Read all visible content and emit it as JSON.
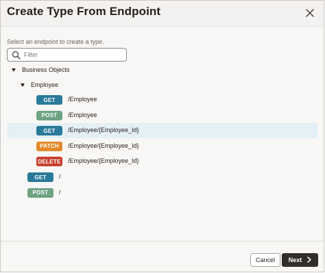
{
  "dialog": {
    "title": "Create Type From Endpoint",
    "helper_text": "Select an endpoint to create a type.",
    "search": {
      "placeholder": "Filter",
      "value": ""
    }
  },
  "tree": {
    "root_label": "Business Objects",
    "child_label": "Employee",
    "employee_endpoints": [
      {
        "method": "GET",
        "path": "/Employee",
        "color": "#2a7a9a",
        "selected": false
      },
      {
        "method": "POST",
        "path": "/Employee",
        "color": "#6fa384",
        "selected": false
      },
      {
        "method": "GET",
        "path": "/Employee/{Employee_Id}",
        "color": "#2a7a9a",
        "selected": true
      },
      {
        "method": "PATCH",
        "path": "/Employee/{Employee_Id}",
        "color": "#e28a2b",
        "selected": false
      },
      {
        "method": "DELETE",
        "path": "/Employee/{Employee_Id}",
        "color": "#c7402e",
        "selected": false
      }
    ],
    "root_endpoints": [
      {
        "method": "GET",
        "path": "/",
        "color": "#2a7a9a"
      },
      {
        "method": "POST",
        "path": "/",
        "color": "#6fa384"
      }
    ]
  },
  "footer": {
    "cancel_label": "Cancel",
    "next_label": "Next"
  },
  "colors": {
    "selected_row": "#e4eff6",
    "primary_button": "#312d2a"
  }
}
